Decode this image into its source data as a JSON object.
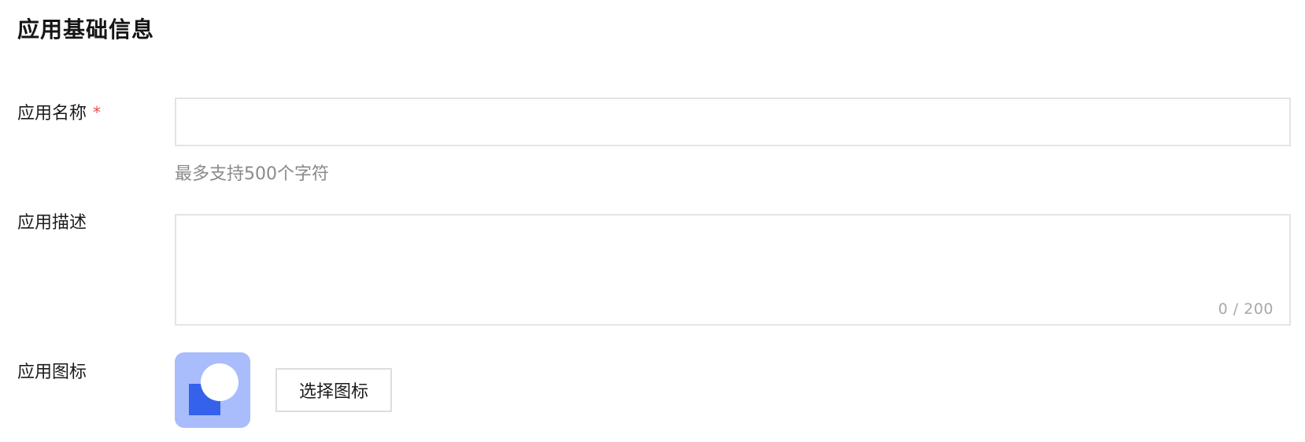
{
  "section": {
    "title": "应用基础信息"
  },
  "form": {
    "name": {
      "label": "应用名称",
      "required_mark": "*",
      "value": "",
      "placeholder": "",
      "hint": "最多支持500个字符"
    },
    "description": {
      "label": "应用描述",
      "value": "",
      "counter": "0 / 200"
    },
    "icon": {
      "label": "应用图标",
      "icon_name": "app-logo-icon",
      "button_label": "选择图标",
      "colors": {
        "tile": "#a9bcfb",
        "square": "#3462ea",
        "circle": "#ffffff"
      }
    }
  },
  "colors": {
    "required": "#e34d4d",
    "border": "#e3e4e8",
    "hint_text": "#8a8a8a"
  }
}
